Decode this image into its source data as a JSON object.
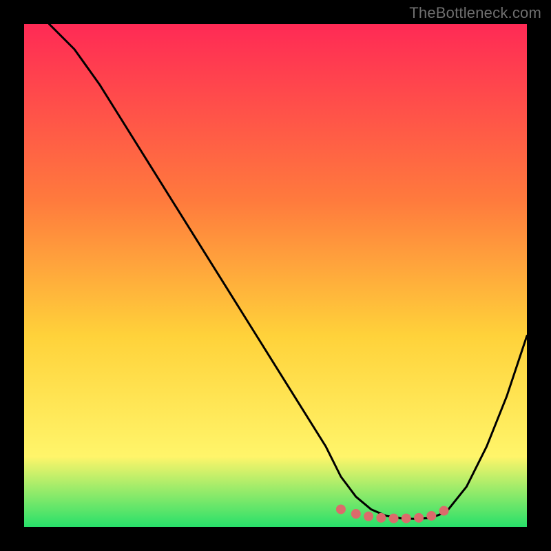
{
  "watermark": "TheBottleneck.com",
  "colors": {
    "black": "#000000",
    "line": "#000000",
    "marker": "#db6b6b",
    "grad_top": "#ff2a55",
    "grad_mid1": "#ff7a3d",
    "grad_mid2": "#ffd23a",
    "grad_mid3": "#fff56a",
    "grad_bottom": "#28e06a"
  },
  "chart_data": {
    "type": "line",
    "title": "",
    "xlabel": "",
    "ylabel": "",
    "ylim": [
      0,
      100
    ],
    "xlim": [
      0,
      100
    ],
    "series": [
      {
        "name": "curve",
        "x": [
          5,
          10,
          15,
          20,
          25,
          30,
          35,
          40,
          45,
          50,
          55,
          60,
          63,
          66,
          69,
          72,
          75,
          78,
          81,
          84,
          88,
          92,
          96,
          100
        ],
        "y": [
          100,
          95,
          88,
          80,
          72,
          64,
          56,
          48,
          40,
          32,
          24,
          16,
          10,
          6,
          3.5,
          2.2,
          1.7,
          1.6,
          1.8,
          3,
          8,
          16,
          26,
          38
        ]
      }
    ],
    "markers": {
      "name": "bottom-cluster",
      "x": [
        63,
        66,
        68.5,
        71,
        73.5,
        76,
        78.5,
        81,
        83.5
      ],
      "y": [
        3.5,
        2.6,
        2.1,
        1.8,
        1.7,
        1.7,
        1.8,
        2.2,
        3.2
      ]
    }
  }
}
